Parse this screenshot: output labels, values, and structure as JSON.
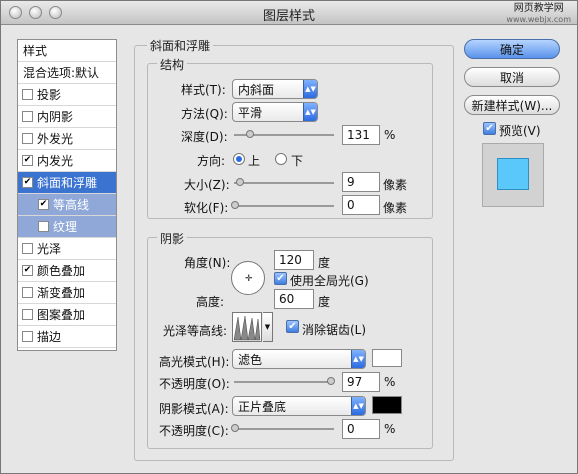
{
  "window": {
    "title": "图层样式"
  },
  "watermark": {
    "line1": "网页教学网",
    "line2": "www.webjx.com"
  },
  "sidebar": {
    "header": "样式",
    "blend": "混合选项:默认",
    "items": [
      {
        "label": "投影",
        "checked": false
      },
      {
        "label": "内阴影",
        "checked": false
      },
      {
        "label": "外发光",
        "checked": false
      },
      {
        "label": "内发光",
        "checked": true
      },
      {
        "label": "斜面和浮雕",
        "checked": true
      },
      {
        "label": "等高线",
        "checked": true
      },
      {
        "label": "纹理",
        "checked": false
      },
      {
        "label": "光泽",
        "checked": false
      },
      {
        "label": "颜色叠加",
        "checked": true
      },
      {
        "label": "渐变叠加",
        "checked": false
      },
      {
        "label": "图案叠加",
        "checked": false
      },
      {
        "label": "描边",
        "checked": false
      }
    ]
  },
  "panel": {
    "section_title": "斜面和浮雕",
    "structure": {
      "title": "结构",
      "style_label": "样式(T):",
      "style_value": "内斜面",
      "method_label": "方法(Q):",
      "method_value": "平滑",
      "depth_label": "深度(D):",
      "depth_value": "131",
      "depth_unit": "%",
      "direction_label": "方向:",
      "dir_up": "上",
      "dir_down": "下",
      "size_label": "大小(Z):",
      "size_value": "9",
      "size_unit": "像素",
      "soften_label": "软化(F):",
      "soften_value": "0",
      "soften_unit": "像素"
    },
    "shading": {
      "title": "阴影",
      "angle_label": "角度(N):",
      "angle_value": "120",
      "angle_unit": "度",
      "global_light": "使用全局光(G)",
      "altitude_label": "高度:",
      "altitude_value": "60",
      "altitude_unit": "度",
      "gloss_label": "光泽等高线:",
      "anti_alias": "消除锯齿(L)",
      "highlight_label": "高光模式(H):",
      "highlight_value": "滤色",
      "highlight_opacity_label": "不透明度(O):",
      "highlight_opacity": "97",
      "shadow_label": "阴影模式(A):",
      "shadow_value": "正片叠底",
      "shadow_opacity_label": "不透明度(C):",
      "shadow_opacity": "0",
      "pct": "%"
    }
  },
  "buttons": {
    "ok": "确定",
    "cancel": "取消",
    "new_style": "新建样式(W)...",
    "preview": "预览(V)"
  },
  "colors": {
    "highlight": "#ffffff",
    "shadow": "#000000",
    "preview_fill": "#5ac8fa"
  }
}
